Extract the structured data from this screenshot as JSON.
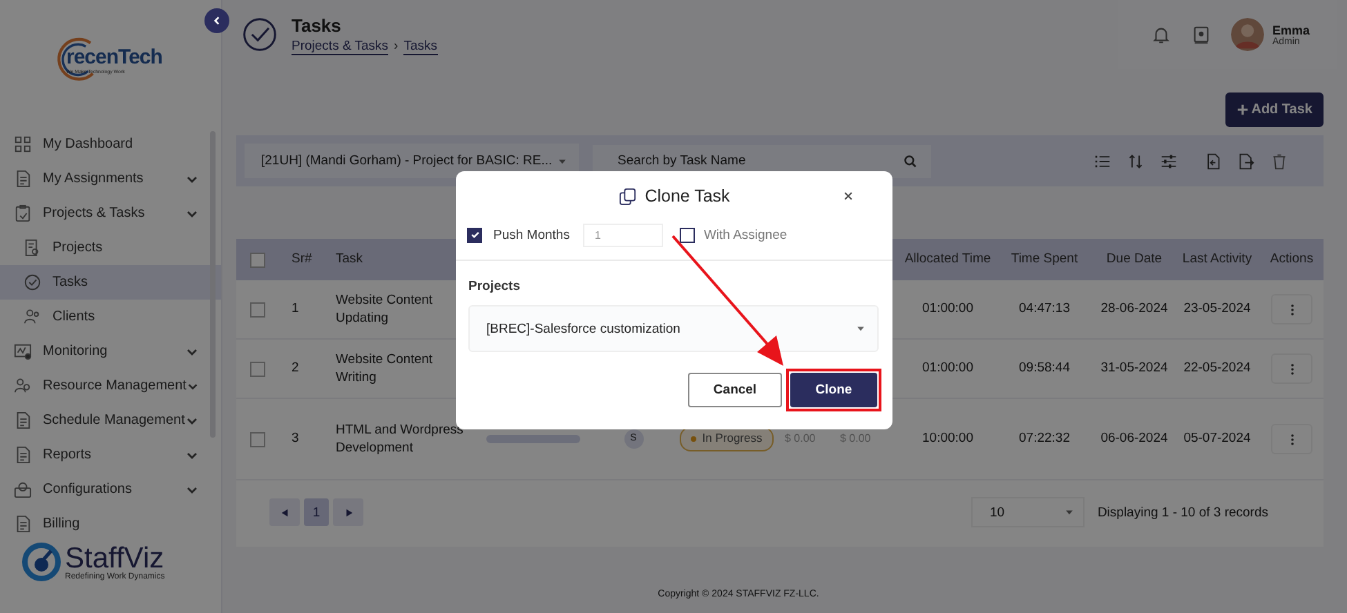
{
  "sidebar": {
    "logo_top": {
      "name": "recenTech",
      "tagline": "We Make Technology Work"
    },
    "items": [
      {
        "label": "My Dashboard",
        "expandable": false
      },
      {
        "label": "My Assignments",
        "expandable": true
      },
      {
        "label": "Projects & Tasks",
        "expandable": true,
        "expanded": true,
        "children": [
          {
            "label": "Projects",
            "selected": false
          },
          {
            "label": "Tasks",
            "selected": true
          },
          {
            "label": "Clients",
            "selected": false
          }
        ]
      },
      {
        "label": "Monitoring",
        "expandable": true
      },
      {
        "label": "Resource Management",
        "expandable": true
      },
      {
        "label": "Schedule Management",
        "expandable": true
      },
      {
        "label": "Reports",
        "expandable": true
      },
      {
        "label": "Configurations",
        "expandable": true
      },
      {
        "label": "Billing",
        "expandable": false
      }
    ],
    "logo_bottom": {
      "name": "StaffViz",
      "tagline": "Redefining Work Dynamics"
    }
  },
  "header": {
    "title": "Tasks",
    "breadcrumb": [
      "Projects & Tasks",
      "Tasks"
    ],
    "separator": "›",
    "user": {
      "name": "Emma",
      "role": "Admin"
    }
  },
  "add_button": "Add Task",
  "filter": {
    "project": "[21UH] (Mandi Gorham) - Project for BASIC: RE...",
    "search": {
      "placeholder": "Search by Task Name"
    }
  },
  "table": {
    "select_all_checked": false,
    "columns": [
      "Sr#",
      "Task",
      "Allocated Time",
      "Time Spent",
      "Due Date",
      "Last Activity",
      "Actions"
    ],
    "rows": [
      {
        "checked": false,
        "sr": "1",
        "task": "Website Content Updating",
        "allocated": "01:00:00",
        "spent": "04:47:13",
        "due": "28-06-2024",
        "last": "23-05-2024"
      },
      {
        "checked": false,
        "sr": "2",
        "task": "Website Content Writing",
        "allocated": "01:00:00",
        "spent": "09:58:44",
        "due": "31-05-2024",
        "last": "22-05-2024"
      },
      {
        "checked": false,
        "sr": "3",
        "task": "HTML and Wordpress Development",
        "progress": {
          "level": 0
        },
        "assignee": "S",
        "status": "In Progress",
        "costs": [
          "$ 0.00",
          "$ 0.00"
        ],
        "allocated": "10:00:00",
        "spent": "07:22:32",
        "due": "06-06-2024",
        "last": "05-07-2024"
      }
    ]
  },
  "pagination": {
    "pages": [
      {
        "label": "1",
        "selected": true
      }
    ],
    "page_size": "10",
    "summary": "Displaying 1 - 10 of 3 records"
  },
  "footer": "Copyright © 2024 STAFFVIZ FZ-LLC.",
  "dialog": {
    "title": "Clone Task",
    "push_months": {
      "label": "Push Months",
      "checked": true,
      "value": "1"
    },
    "with_assignee": {
      "label": "With Assignee",
      "checked": false
    },
    "projects_label": "Projects",
    "project": "[BREC]-Salesforce customization",
    "buttons": [
      {
        "label": "Cancel",
        "kind": "secondary",
        "highlighted": false
      },
      {
        "label": "Clone",
        "kind": "primary",
        "highlighted": true
      }
    ]
  }
}
